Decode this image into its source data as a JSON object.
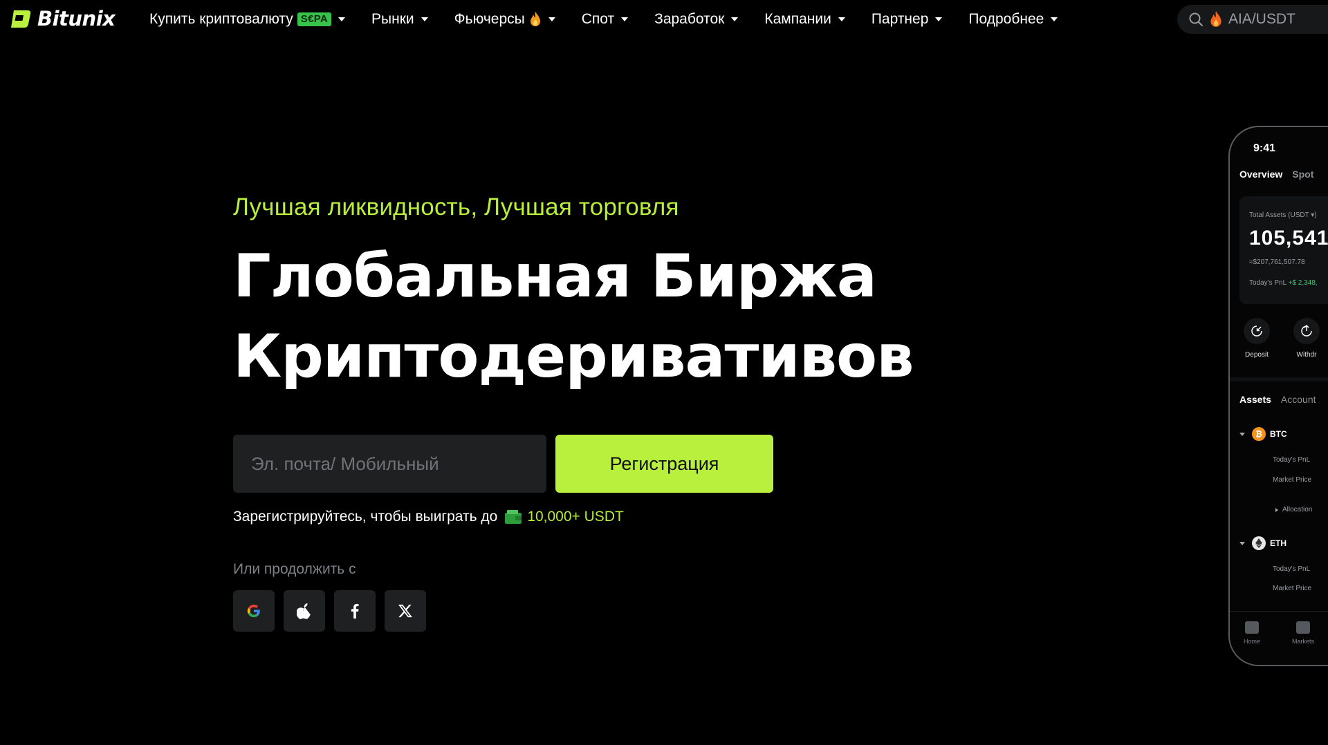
{
  "brand": {
    "name": "Bitunix",
    "accent_color": "#b9f03e"
  },
  "nav": {
    "items": [
      {
        "label": "Купить криптовалюту",
        "badge": "S€PA"
      },
      {
        "label": "Рынки"
      },
      {
        "label": "Фьючерсы",
        "icon": "fire-icon"
      },
      {
        "label": "Спот"
      },
      {
        "label": "Заработок"
      },
      {
        "label": "Кампании"
      },
      {
        "label": "Партнер"
      },
      {
        "label": "Подробнее"
      }
    ]
  },
  "search": {
    "text": "AIA/USDT",
    "icon": "search-icon"
  },
  "hero": {
    "tagline": "Лучшая ликвидность, Лучшая торговля",
    "headline_line1": "Глобальная Биржа",
    "headline_line2": "Криптодеривативов",
    "email_placeholder": "Эл. почта/ Мобильный",
    "register_label": "Регистрация",
    "promo_text": "Зарегистрируйтесь, чтобы выиграть до",
    "promo_amount": "10,000+ USDT",
    "continue_label": "Или продолжить с",
    "social": [
      "google-icon",
      "apple-icon",
      "facebook-icon",
      "x-icon"
    ]
  },
  "phone": {
    "time": "9:41",
    "tabs": [
      "Overview",
      "Spot"
    ],
    "total_assets_label": "Total Assets (USDT ▾)",
    "total_assets_value": "105,541,",
    "total_assets_usd": "≈$207,761,507.78",
    "pnl_label": "Today's PnL",
    "pnl_value": "+$ 2,348,",
    "actions": [
      "Deposit",
      "Withdr"
    ],
    "subtabs": [
      "Assets",
      "Account"
    ],
    "assets": [
      {
        "symbol": "BTC",
        "rows": [
          "Today's PnL",
          "Market Price"
        ],
        "allocation": "Allocation"
      },
      {
        "symbol": "ETH",
        "rows": [
          "Today's PnL",
          "Market Price"
        ]
      }
    ],
    "bottom_nav": [
      "Home",
      "Markets"
    ]
  }
}
